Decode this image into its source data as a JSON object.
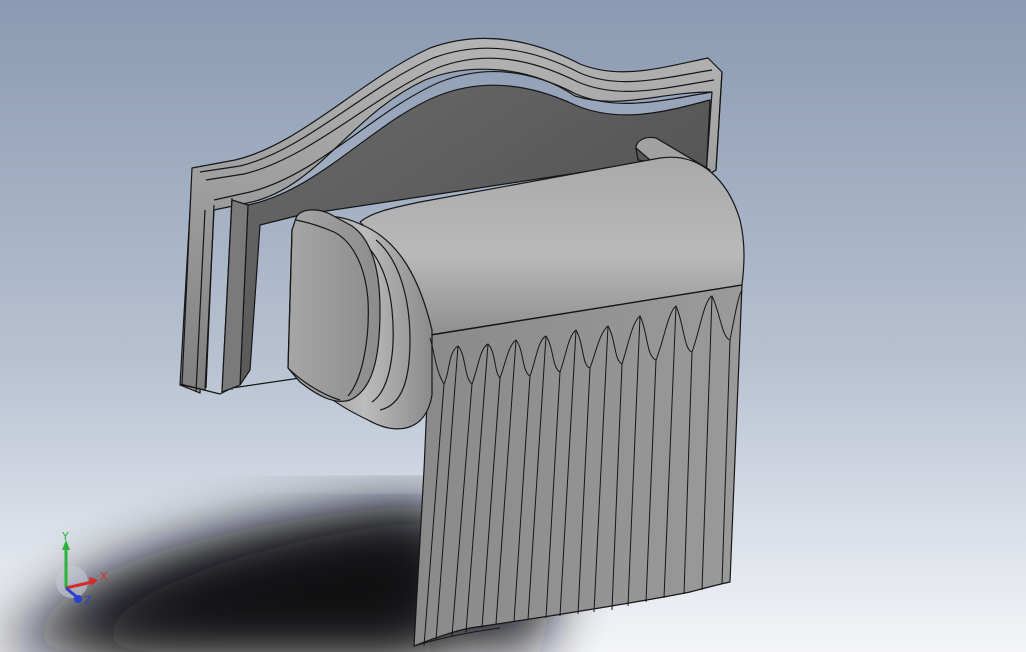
{
  "viewport": {
    "background_top": "#8c9bb2",
    "background_bottom": "#f2f4f8",
    "model_face_color": "#9b9b9b",
    "model_edge_color": "#161616"
  },
  "model": {
    "name": "toilet-paper-holder"
  },
  "triad": {
    "x_label": "X",
    "y_label": "Y",
    "z_label": "Z",
    "x_color": "#d22b2b",
    "y_color": "#2bb33a",
    "z_color": "#2b3fd2"
  }
}
